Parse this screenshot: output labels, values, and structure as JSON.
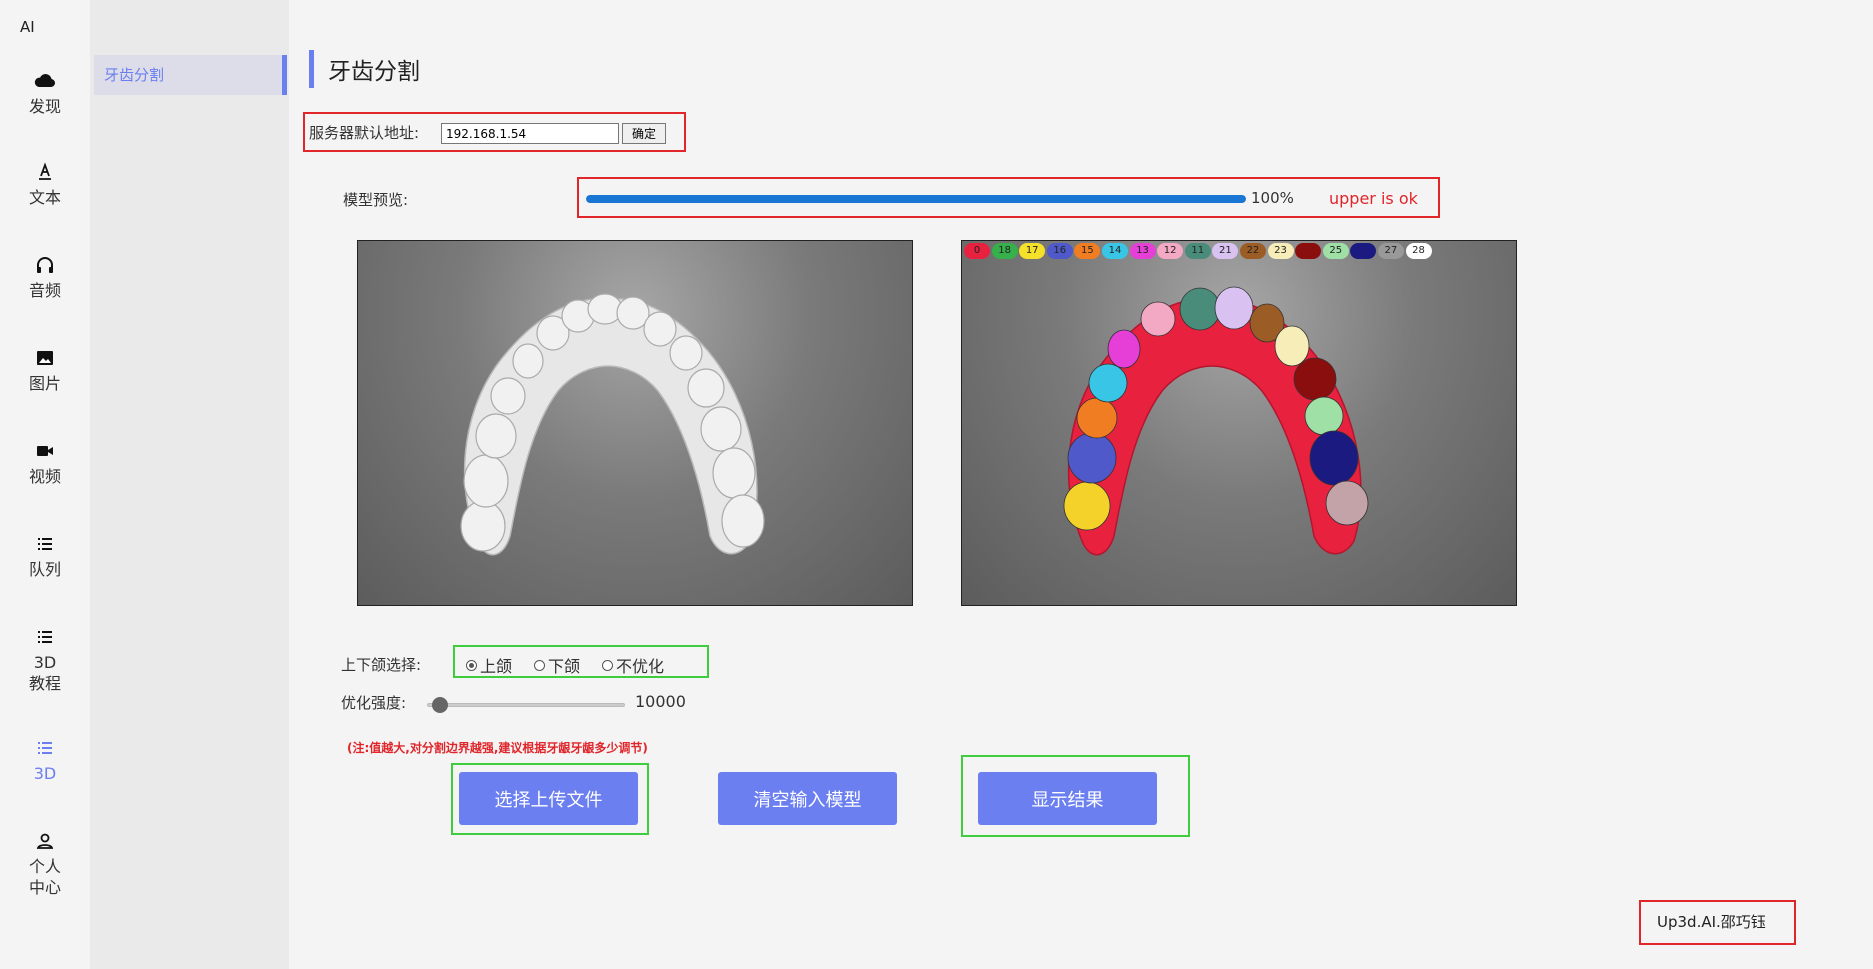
{
  "app": {
    "logo": "AI"
  },
  "rail": [
    {
      "label": "发现",
      "icon": "cloud-icon"
    },
    {
      "label": "文本",
      "icon": "text-icon"
    },
    {
      "label": "音频",
      "icon": "headphones-icon"
    },
    {
      "label": "图片",
      "icon": "image-icon"
    },
    {
      "label": "视频",
      "icon": "video-camera-icon"
    },
    {
      "label": "队列",
      "icon": "list-icon"
    },
    {
      "label": "3D\n教程",
      "icon": "list-icon"
    },
    {
      "label": "3D",
      "icon": "list-icon",
      "active": true
    },
    {
      "label": "个人\n中心",
      "icon": "user-icon"
    }
  ],
  "subnav": {
    "active_item": "牙齿分割"
  },
  "page": {
    "title": "牙齿分割"
  },
  "server": {
    "label": "服务器默认地址:",
    "address": "192.168.1.54",
    "confirm_label": "确定"
  },
  "preview": {
    "label": "模型预览:",
    "progress_percent": 100,
    "progress_text": "100%",
    "status": "upper is ok"
  },
  "legend": [
    {
      "label": "0",
      "color": "#e8213f"
    },
    {
      "label": "18",
      "color": "#35b04a"
    },
    {
      "label": "17",
      "color": "#f5e12a"
    },
    {
      "label": "16",
      "color": "#4f59c9"
    },
    {
      "label": "15",
      "color": "#f07d22"
    },
    {
      "label": "14",
      "color": "#39c6e6"
    },
    {
      "label": "13",
      "color": "#e53fd8"
    },
    {
      "label": "12",
      "color": "#f3a9c3"
    },
    {
      "label": "11",
      "color": "#4a8c7a"
    },
    {
      "label": "21",
      "color": "#d9c2f2"
    },
    {
      "label": "22",
      "color": "#9c5c25"
    },
    {
      "label": "23",
      "color": "#f7edb8"
    },
    {
      "label": "24",
      "color": "#8b0e0e"
    },
    {
      "label": "25",
      "color": "#9fe0a7"
    },
    {
      "label": "26",
      "color": "#1a1a80"
    },
    {
      "label": "27",
      "color": "#999999"
    },
    {
      "label": "28",
      "color": "#ffffff"
    }
  ],
  "jaw": {
    "label": "上下颌选择:",
    "options": [
      "上颌",
      "下颌",
      "不优化"
    ],
    "selected": "上颌"
  },
  "strength": {
    "label": "优化强度:",
    "value": "10000"
  },
  "note": "(注:值越大,对分割边界越强,建议根据牙龈牙龈多少调节)",
  "buttons": {
    "upload": "选择上传文件",
    "clear": "清空输入模型",
    "show": "显示结果"
  },
  "footer": {
    "credit": "Up3d.AI.邵巧钰"
  }
}
